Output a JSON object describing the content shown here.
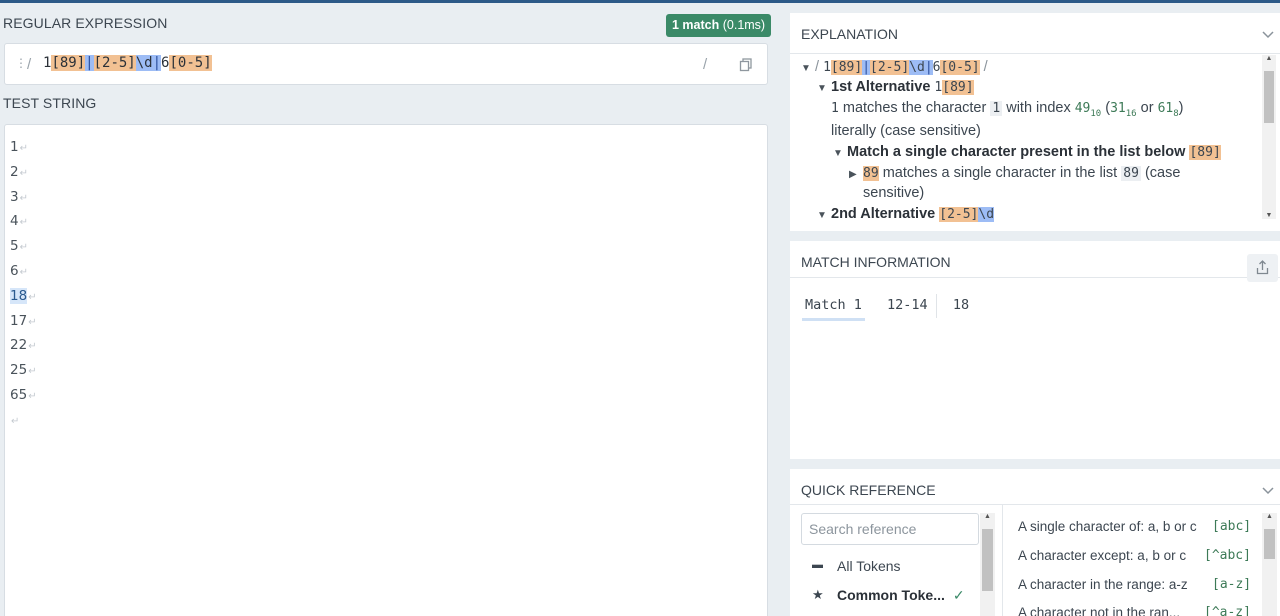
{
  "regex_panel": {
    "title": "REGULAR EXPRESSION",
    "match_badge": "1 match",
    "match_time": "(0.1ms)",
    "delimiter_open": "/",
    "delimiter_close": "/",
    "regex_tokens": [
      {
        "text": "1",
        "kind": "plain"
      },
      {
        "text": "[89]",
        "kind": "set"
      },
      {
        "text": "|",
        "kind": "alt"
      },
      {
        "text": "[2-5]",
        "kind": "set"
      },
      {
        "text": "\\d",
        "kind": "esc"
      },
      {
        "text": "|",
        "kind": "alt"
      },
      {
        "text": "6",
        "kind": "plain"
      },
      {
        "text": "[0-5]",
        "kind": "set"
      }
    ],
    "copy_icon": "copy-icon"
  },
  "test_panel": {
    "title": "TEST STRING",
    "lines": [
      "1",
      "2",
      "3",
      "4",
      "5",
      "6",
      "18",
      "17",
      "22",
      "25",
      "65",
      ""
    ],
    "highlighted_line": "18"
  },
  "explanation": {
    "title": "EXPLANATION",
    "root_delim_open": "/ ",
    "root_delim_close": " /",
    "alt1_title": "1st Alternative",
    "alt1_token": "1",
    "alt1_set": "[89]",
    "desc1_lit": "1",
    "desc1_mid": "matches the character",
    "desc1_char": "1",
    "desc1_with": "with index",
    "desc1_dec": "49",
    "desc1_dec_base": "10",
    "desc1_hex": "31",
    "desc1_hex_base": "16",
    "desc1_or": "or",
    "desc1_oct": "61",
    "desc1_oct_base": "8",
    "desc1_tail": "literally (case sensitive)",
    "match_set_title": "Match a single character present in the list below",
    "match_set_token": "[89]",
    "set_item_token": "89",
    "set_item_text": "matches a single character in the list",
    "set_item_lit": "89",
    "set_item_case": "(case",
    "set_item_tail": "sensitive)",
    "alt2_title": "2nd Alternative",
    "alt2_set": "[2-5]",
    "alt2_esc": "\\d"
  },
  "match_info": {
    "title": "MATCH INFORMATION",
    "match_label": "Match 1",
    "match_range": "12-14",
    "match_value": "18",
    "share_icon": "share-icon"
  },
  "quick_reference": {
    "title": "QUICK REFERENCE",
    "search_placeholder": "Search reference",
    "categories": [
      {
        "label": "All Tokens",
        "icon": "stack-icon"
      },
      {
        "label": "Common Toke...",
        "icon": "star-icon",
        "selected": true
      }
    ],
    "rows": [
      {
        "text": "A single character of: a, b or c",
        "token": "[abc]"
      },
      {
        "text": "A character except: a, b or c",
        "token": "[^abc]"
      },
      {
        "text": "A character in the range: a-z",
        "token": "[a-z]"
      },
      {
        "text": "A character not in the ran...",
        "token": "[^a-z]"
      }
    ]
  },
  "colors": {
    "badge": "#3b8a68",
    "set_token": "#f2c193",
    "alt_token": "#9dbcf5",
    "header_bar": "#2d5a88"
  }
}
